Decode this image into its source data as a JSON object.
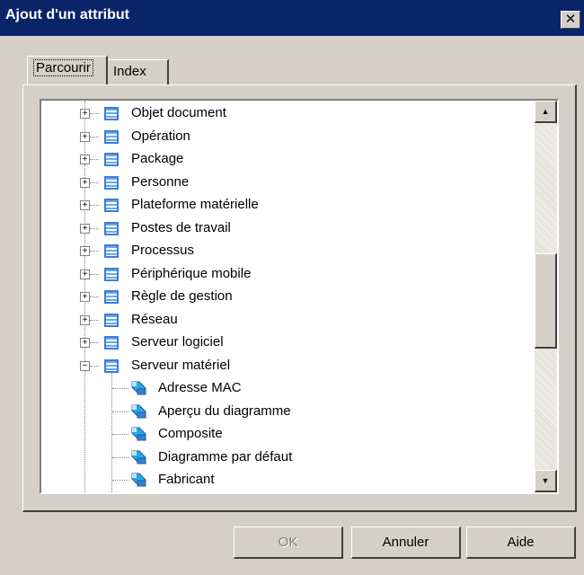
{
  "window": {
    "title": "Ajout d'un attribut",
    "close_symbol": "✕"
  },
  "tabs": [
    {
      "label": "Parcourir",
      "active": true
    },
    {
      "label": "Index",
      "active": false
    }
  ],
  "tree": {
    "items": [
      {
        "label": "Objet document",
        "kind": "class",
        "expander": "+"
      },
      {
        "label": "Opération",
        "kind": "class",
        "expander": "+"
      },
      {
        "label": "Package",
        "kind": "class",
        "expander": "+"
      },
      {
        "label": "Personne",
        "kind": "class",
        "expander": "+"
      },
      {
        "label": "Plateforme matérielle",
        "kind": "class",
        "expander": "+"
      },
      {
        "label": "Postes de travail",
        "kind": "class",
        "expander": "+"
      },
      {
        "label": "Processus",
        "kind": "class",
        "expander": "+"
      },
      {
        "label": "Périphérique mobile",
        "kind": "class",
        "expander": "+"
      },
      {
        "label": "Règle de gestion",
        "kind": "class",
        "expander": "+"
      },
      {
        "label": "Réseau",
        "kind": "class",
        "expander": "+"
      },
      {
        "label": "Serveur logiciel",
        "kind": "class",
        "expander": "+"
      },
      {
        "label": "Serveur matériel",
        "kind": "class",
        "expander": "−"
      },
      {
        "label": "Adresse MAC",
        "kind": "attribute"
      },
      {
        "label": "Aperçu du diagramme",
        "kind": "attribute"
      },
      {
        "label": "Composite",
        "kind": "attribute"
      },
      {
        "label": "Diagramme par défaut",
        "kind": "attribute"
      },
      {
        "label": "Fabricant",
        "kind": "attribute"
      }
    ],
    "class_icon": "class-icon",
    "attribute_icon": "attribute-icon"
  },
  "scrollbar": {
    "up_arrow": "▲",
    "down_arrow": "▼"
  },
  "buttons": {
    "ok": "OK",
    "ok_enabled": false,
    "cancel": "Annuler",
    "help": "Aide"
  },
  "colors": {
    "titlebar": "#0a246a",
    "face": "#d4d0c8",
    "icon_blue": "#3a7fd5",
    "icon_cyan": "#29a8e0"
  }
}
